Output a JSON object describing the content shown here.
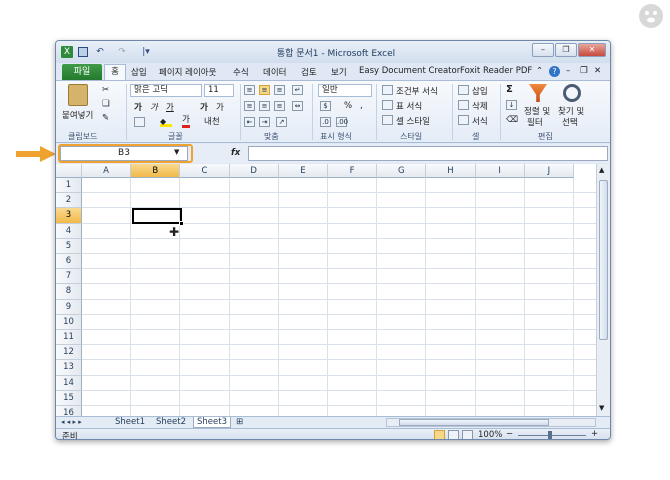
{
  "window": {
    "title": "통합 문서1 - Microsoft Excel",
    "qat_undo": "↶",
    "qat_redo": "↷",
    "qat_customize": "|▾",
    "minimize": "–",
    "restore": "❐",
    "close": "✕"
  },
  "tabs": {
    "file": "파일",
    "home": "홈",
    "insert": "삽입",
    "page_layout": "페이지 레이아웃",
    "formulas": "수식",
    "data": "데이터",
    "review": "검토",
    "view": "보기",
    "easy_doc": "Easy Document Creator",
    "foxit": "Foxit Reader PDF"
  },
  "ribbon": {
    "clipboard": {
      "label": "클립보드",
      "paste": "붙여넣기"
    },
    "font": {
      "label": "글꼴",
      "name": "맑은 고딕",
      "size": "11",
      "bold": "가",
      "italic": "가",
      "underline": "가",
      "grow": "가",
      "shrink": "가",
      "color": "가",
      "phonetic": "내천"
    },
    "alignment": {
      "label": "맞춤"
    },
    "number": {
      "label": "표시 형식",
      "format": "일반",
      "percent": "%",
      "comma": ","
    },
    "styles": {
      "label": "스타일",
      "conditional": "조건부 서식",
      "table": "표 서식",
      "cell_styles": "셀 스타일"
    },
    "cells": {
      "label": "셀",
      "insert": "삽입",
      "delete": "삭제",
      "format": "서식"
    },
    "editing": {
      "label": "편집",
      "sort_line1": "정렬 및",
      "sort_line2": "필터",
      "find_line1": "찾기 및",
      "find_line2": "선택",
      "sigma": "Σ"
    }
  },
  "formula_bar": {
    "name_box": "B3",
    "fx": "fx",
    "value": ""
  },
  "grid": {
    "columns": [
      "A",
      "B",
      "C",
      "D",
      "E",
      "F",
      "G",
      "H",
      "I",
      "J"
    ],
    "rows": [
      "1",
      "2",
      "3",
      "4",
      "5",
      "6",
      "7",
      "8",
      "9",
      "10",
      "11",
      "12",
      "13",
      "14",
      "15",
      "16"
    ],
    "selected_column": "B",
    "selected_row": "3"
  },
  "sheets": {
    "nav": "◂ ◂ ▸ ▸",
    "names": [
      "Sheet1",
      "Sheet2",
      "Sheet3"
    ],
    "active": "Sheet3"
  },
  "status": {
    "ready": "준비",
    "zoom": "100%",
    "zoom_out": "−",
    "zoom_in": "+"
  },
  "colors": {
    "accent": "#f1b949",
    "file_tab": "#2e8b3b",
    "arrow": "#f0a22e"
  }
}
